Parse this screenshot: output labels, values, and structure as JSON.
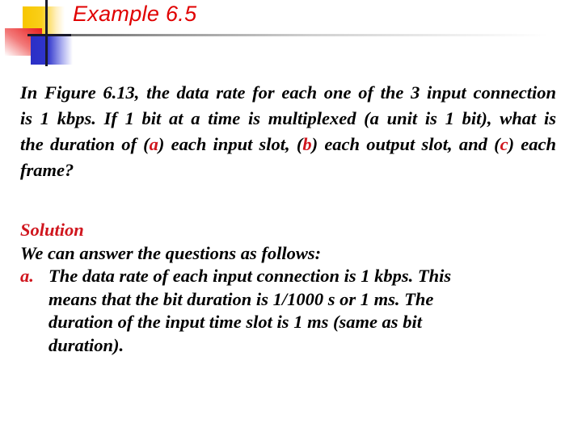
{
  "slide": {
    "title": "Example 6.5",
    "accent_color": "#e00000",
    "problem": {
      "part1": "In Figure 6.13, the data rate for each one of the 3 input connection is 1 kbps. If 1 bit at a time is multiplexed (a unit is 1 bit), what is the duration of (",
      "marker_a": "a",
      "part2": ") each input slot, (",
      "marker_b": "b",
      "part3": ") each output slot, and (",
      "marker_c": "c",
      "part4": ") each frame?"
    },
    "solution": {
      "heading": "Solution",
      "intro": "We can answer the questions as follows:",
      "answers": [
        {
          "marker": "a.",
          "lines": [
            "The data rate of each input connection is 1 kbps. This",
            "means that the bit duration is 1/1000 s or 1 ms. The",
            "duration of the input time slot is 1 ms (same as bit",
            "duration)."
          ]
        }
      ]
    }
  }
}
